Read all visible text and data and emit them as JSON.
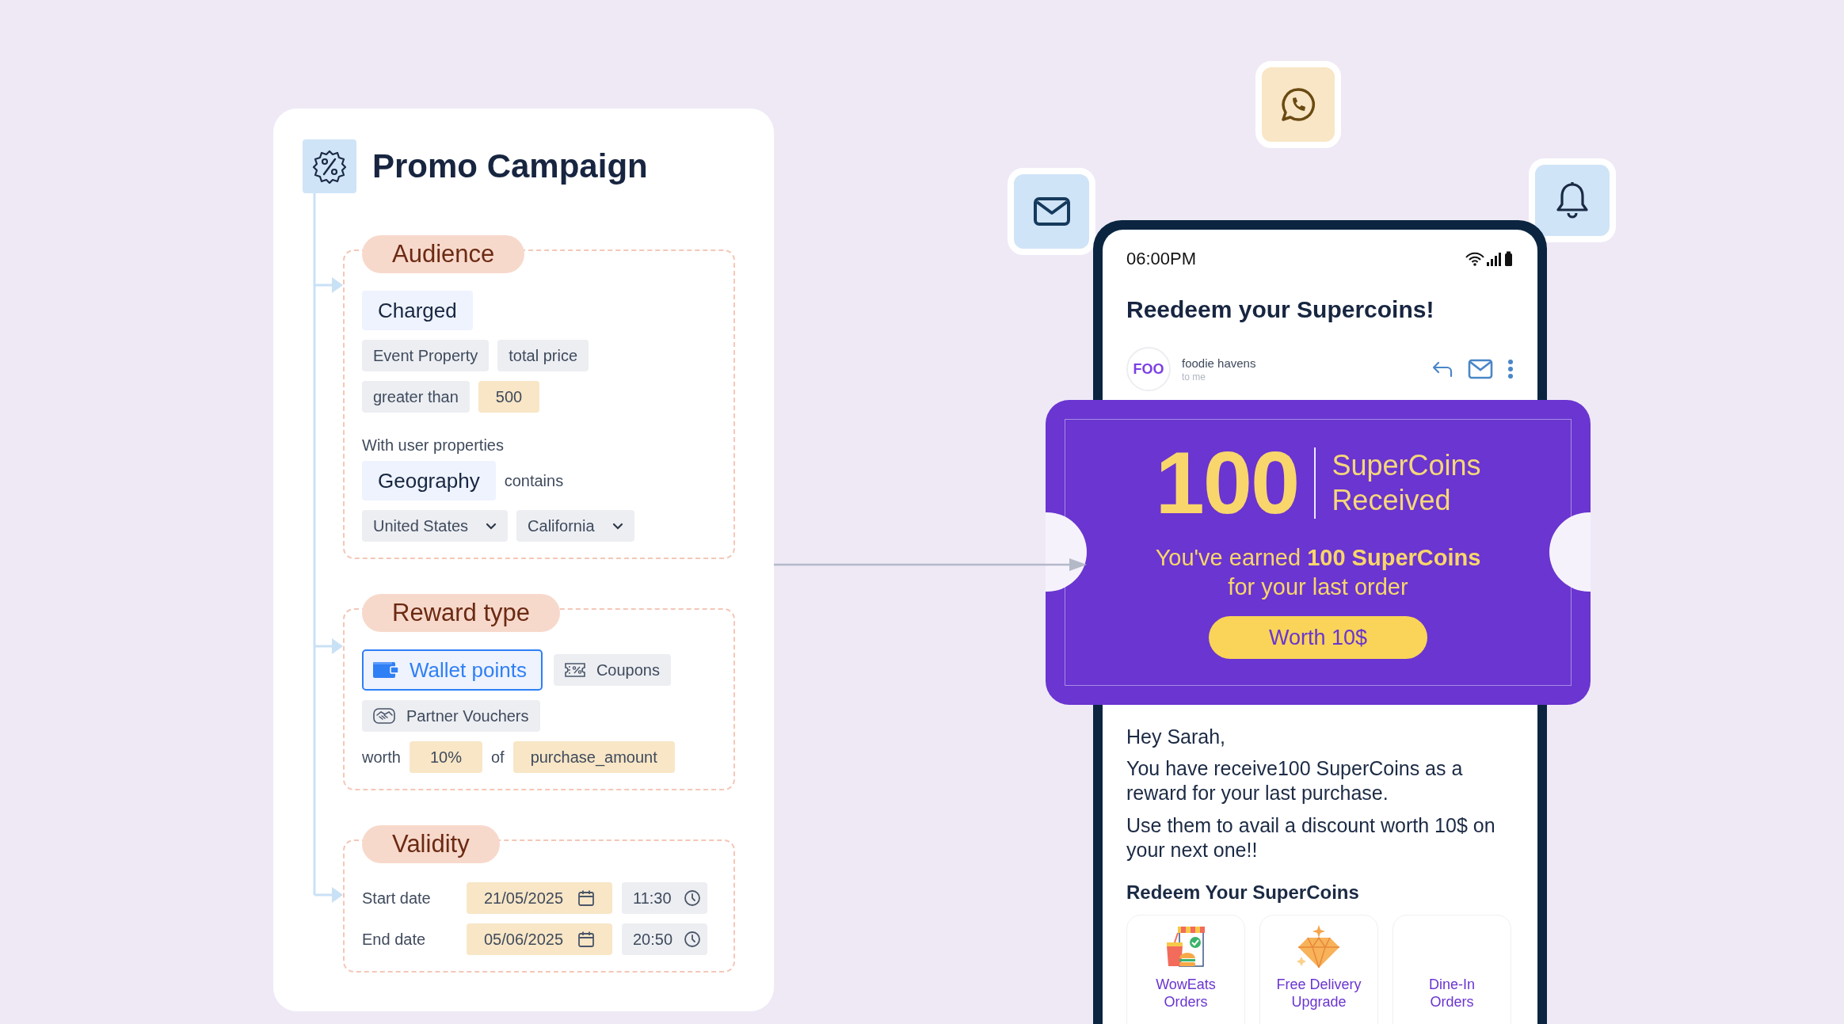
{
  "campaign": {
    "title": "Promo Campaign",
    "audience": {
      "heading": "Audience",
      "event": "Charged",
      "condition_rows": [
        [
          {
            "text": "Event Property",
            "kind": "neutral"
          },
          {
            "text": "total price",
            "kind": "neutral"
          }
        ],
        [
          {
            "text": "greater than",
            "kind": "neutral"
          },
          {
            "text": "500",
            "kind": "value"
          }
        ]
      ],
      "user_properties_label": "With user properties",
      "property": "Geography",
      "operator": "contains",
      "dropdowns": [
        "United States",
        "California"
      ]
    },
    "reward": {
      "heading": "Reward type",
      "options": [
        {
          "label": "Wallet points",
          "kind": "wallet",
          "selected": true
        },
        {
          "label": "Coupons",
          "kind": "coupon",
          "selected": false
        },
        {
          "label": "Partner Vouchers",
          "kind": "voucher",
          "selected": false
        }
      ],
      "worth_label": "worth",
      "percent": "10%",
      "of_label": "of",
      "field": "purchase_amount"
    },
    "validity": {
      "heading": "Validity",
      "rows": [
        {
          "label": "Start date",
          "date": "21/05/2025",
          "time": "11:30"
        },
        {
          "label": "End date",
          "date": "05/06/2025",
          "time": "20:50"
        }
      ]
    }
  },
  "phone": {
    "time": "06:00PM",
    "subject": "Reedeem your Supercoins!",
    "logo": "FOO",
    "sender": "foodie havens",
    "recipient": "to me",
    "coupon": {
      "amount": "100",
      "unit": "SuperCoins",
      "status": "Received",
      "message": "You've earned **100 SuperCoins** for your last order",
      "button": "Worth 10$"
    },
    "greeting": "Hey Sarah,",
    "paragraphs": [
      "You have receive100 SuperCoins as a reward for your last purchase.",
      "Use them to avail a discount worth 10$ on your next one!!"
    ],
    "redeem_title": "Redeem Your SuperCoins",
    "redeem_options": [
      {
        "label": "WowEats Orders",
        "kind": "store"
      },
      {
        "label": "Free Delivery Upgrade",
        "kind": "gem"
      },
      {
        "label": "Dine-In Orders",
        "kind": "plain"
      }
    ]
  }
}
